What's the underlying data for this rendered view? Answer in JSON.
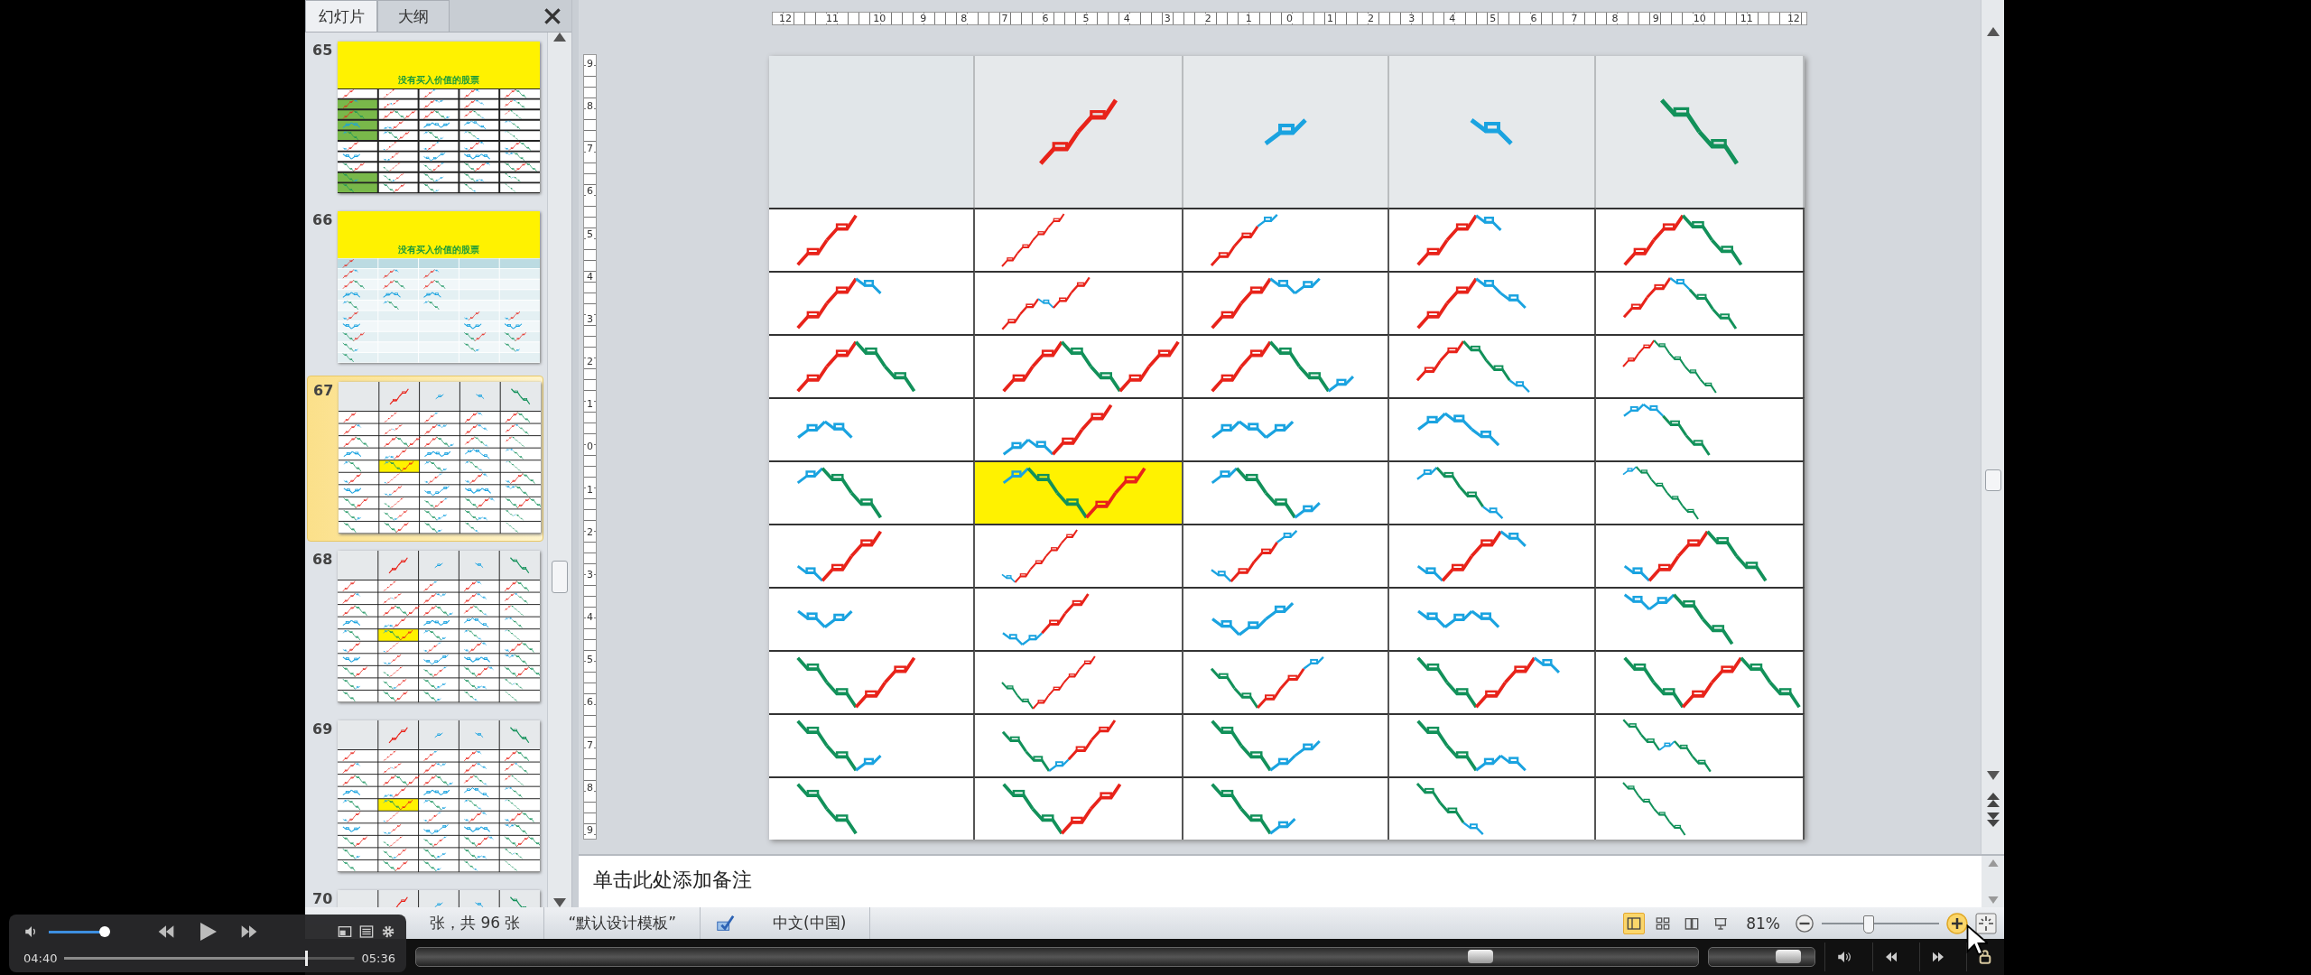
{
  "panel_tabs": [
    {
      "label": "幻灯片",
      "selected": true
    },
    {
      "label": "大纲",
      "selected": false
    }
  ],
  "thumbnails": [
    {
      "number": "65",
      "kind": "title-grid",
      "title": "没有买入价值的股票",
      "selected": false
    },
    {
      "number": "66",
      "kind": "title-light",
      "title": "没有买入价值的股票",
      "selected": false
    },
    {
      "number": "67",
      "kind": "grid",
      "selected": true
    },
    {
      "number": "68",
      "kind": "grid",
      "selected": false
    },
    {
      "number": "69",
      "kind": "grid",
      "selected": false
    },
    {
      "number": "70",
      "kind": "grid",
      "selected": false
    }
  ],
  "rulers": {
    "horizontal": [
      "12",
      "11",
      "10",
      "9",
      "8",
      "7",
      "6",
      "5",
      "4",
      "3",
      "2",
      "1",
      "0",
      "1",
      "2",
      "3",
      "4",
      "5",
      "6",
      "7",
      "8",
      "9",
      "10",
      "11",
      "12"
    ],
    "vertical": [
      "9",
      "8",
      "7",
      "6",
      "5",
      "4",
      "3",
      "2",
      "1",
      "0",
      "1",
      "2",
      "3",
      "4",
      "5",
      "6",
      "7",
      "8",
      "9"
    ]
  },
  "slide_table": {
    "rows": [
      {
        "cells": [
          {
            "highlighted": false
          },
          {
            "highlighted": false
          },
          {
            "highlighted": false
          },
          {
            "highlighted": false
          },
          {
            "highlighted": false
          }
        ]
      },
      {
        "cells": [
          {
            "highlighted": false
          },
          {
            "highlighted": false
          },
          {
            "highlighted": false
          },
          {
            "highlighted": false
          },
          {
            "highlighted": false
          }
        ]
      },
      {
        "cells": [
          {
            "highlighted": false
          },
          {
            "highlighted": false
          },
          {
            "highlighted": false
          },
          {
            "highlighted": false
          },
          {
            "highlighted": false
          }
        ]
      },
      {
        "cells": [
          {
            "highlighted": false
          },
          {
            "highlighted": false
          },
          {
            "highlighted": false
          },
          {
            "highlighted": false
          },
          {
            "highlighted": false
          }
        ]
      },
      {
        "cells": [
          {
            "highlighted": false
          },
          {
            "highlighted": true
          },
          {
            "highlighted": false
          },
          {
            "highlighted": false
          },
          {
            "highlighted": false
          }
        ]
      },
      {
        "cells": [
          {
            "highlighted": false
          },
          {
            "highlighted": false
          },
          {
            "highlighted": false
          },
          {
            "highlighted": false
          },
          {
            "highlighted": false
          }
        ]
      },
      {
        "cells": [
          {
            "highlighted": false
          },
          {
            "highlighted": false
          },
          {
            "highlighted": false
          },
          {
            "highlighted": false
          },
          {
            "highlighted": false
          }
        ]
      },
      {
        "cells": [
          {
            "highlighted": false
          },
          {
            "highlighted": false
          },
          {
            "highlighted": false
          },
          {
            "highlighted": false
          },
          {
            "highlighted": false
          }
        ]
      },
      {
        "cells": [
          {
            "highlighted": false
          },
          {
            "highlighted": false
          },
          {
            "highlighted": false
          },
          {
            "highlighted": false
          },
          {
            "highlighted": false
          }
        ]
      },
      {
        "cells": [
          {
            "highlighted": false
          },
          {
            "highlighted": false
          },
          {
            "highlighted": false
          },
          {
            "highlighted": false
          },
          {
            "highlighted": false
          }
        ]
      }
    ]
  },
  "notes": {
    "placeholder": "单击此处添加备注"
  },
  "status_bar": {
    "slide_info": "张，共 96 张",
    "theme": "“默认设计模板”",
    "language": "中文(中国)",
    "view_buttons": [
      {
        "kind": "normal",
        "selected": true
      },
      {
        "kind": "sorter",
        "selected": false
      },
      {
        "kind": "reading",
        "selected": false
      },
      {
        "kind": "show",
        "selected": false
      }
    ],
    "zoom": "81%",
    "zoom_slider": {
      "level": 0.4
    }
  },
  "video_player": {
    "volume": {
      "level": 1
    },
    "elapsed": "04:40",
    "progress": {
      "level": 0.83
    },
    "duration": "05:36"
  },
  "host_bar": {
    "seek": {
      "level": 0.83
    },
    "volume": {
      "level": 0.75
    }
  }
}
